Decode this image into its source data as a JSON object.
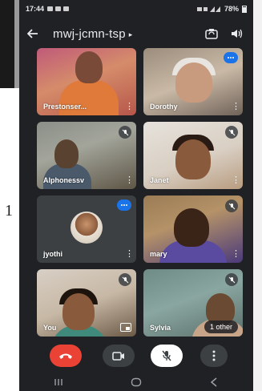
{
  "status_bar": {
    "time": "17:44",
    "battery": "78%"
  },
  "header": {
    "meeting_code": "mwj-jcmn-tsp"
  },
  "participants": [
    {
      "name": "Prestonser...",
      "mic": "on"
    },
    {
      "name": "Dorothy",
      "mic": "on",
      "speaking": true
    },
    {
      "name": "Alphonessv",
      "mic": "off"
    },
    {
      "name": "Janet",
      "mic": "off"
    },
    {
      "name": "jyothi",
      "mic": "on",
      "speaking": true
    },
    {
      "name": "mary",
      "mic": "off"
    },
    {
      "name": "You",
      "mic": "off"
    },
    {
      "name": "Sylvia",
      "mic": "off"
    }
  ],
  "overflow_chip": "1 other",
  "colors": {
    "end_call": "#ea4335",
    "speaking": "#1a73e8",
    "background": "#202124"
  },
  "icons": {
    "back": "arrow-left-icon",
    "flip_camera": "flip-camera-icon",
    "audio": "speaker-icon",
    "end": "phone-hangup-icon",
    "camera": "video-camera-icon",
    "mic": "mic-off-icon",
    "more": "more-vert-icon"
  }
}
